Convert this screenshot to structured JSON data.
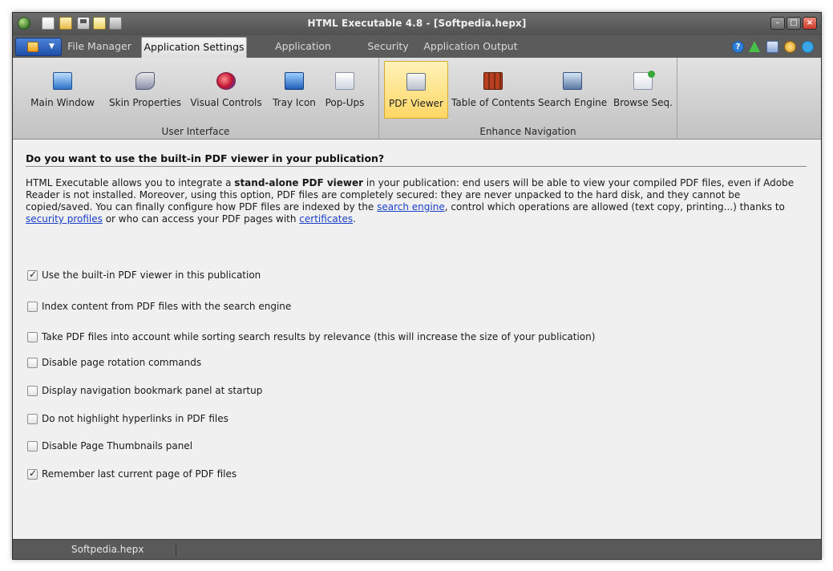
{
  "window": {
    "title": "HTML Executable 4.8 - [Softpedia.hepx]"
  },
  "quick_access": [
    "app-icon",
    "new-file-icon",
    "open-file-icon",
    "save-icon",
    "edit-icon",
    "build-icon"
  ],
  "tabs": [
    {
      "label": "File Manager",
      "active": false
    },
    {
      "label": "Application Settings",
      "active": true
    },
    {
      "label": "Application Behavior",
      "active": false
    },
    {
      "label": "Security",
      "active": false
    },
    {
      "label": "Application Output",
      "active": false
    }
  ],
  "top_right_icons": [
    "help-icon",
    "update-icon",
    "network-icon",
    "star-icon",
    "twitter-icon"
  ],
  "ribbon": {
    "groups": [
      {
        "label": "User Interface",
        "buttons": [
          {
            "label": "Main Window",
            "icon": "monitor-icon"
          },
          {
            "label": "Skin Properties",
            "icon": "brush-icon"
          },
          {
            "label": "Visual Controls",
            "icon": "controls-icon"
          },
          {
            "label": "Tray Icon",
            "icon": "tray-icon"
          },
          {
            "label": "Pop-Ups",
            "icon": "popups-icon"
          }
        ]
      },
      {
        "label": "Enhance Navigation",
        "buttons": [
          {
            "label": "PDF Viewer",
            "icon": "pdf-viewer-icon",
            "selected": true
          },
          {
            "label": "Table of Contents",
            "icon": "books-icon"
          },
          {
            "label": "Search Engine",
            "icon": "search-engine-icon"
          },
          {
            "label": "Browse Seq.",
            "icon": "browse-sequence-icon"
          }
        ]
      }
    ]
  },
  "content": {
    "heading": "Do you want to use the built-in PDF viewer in your publication?",
    "desc": {
      "p1": "HTML Executable allows you to integrate a ",
      "b1": "stand-alone PDF viewer",
      "p2": " in your publication: end users will be able to view your compiled PDF files, even if Adobe Reader is not installed. Moreover, using this option, PDF files are completely secured: they are never unpacked to the hard disk, and they cannot be copied/saved. You can finally configure how PDF files are indexed by the ",
      "link1": "search engine",
      "p3": ", control which operations are allowed (text copy, printing...) thanks to ",
      "link2": "security profiles",
      "p4": " or who can access your PDF pages with ",
      "link3": "certificates",
      "p5": "."
    },
    "options": [
      {
        "label": "Use the built-in PDF viewer in this publication",
        "checked": true
      },
      {
        "label": "Index content from PDF files with the search engine",
        "checked": false
      },
      {
        "label": "Take PDF files into account while sorting search results by relevance (this will increase the size of your publication)",
        "checked": false
      },
      {
        "label": "Disable page rotation commands",
        "checked": false
      },
      {
        "label": "Display navigation bookmark panel at startup",
        "checked": false
      },
      {
        "label": "Do not highlight hyperlinks in PDF files",
        "checked": false
      },
      {
        "label": "Disable Page Thumbnails panel",
        "checked": false
      },
      {
        "label": "Remember last current page of PDF files",
        "checked": true
      }
    ]
  },
  "status": {
    "file": "Softpedia.hepx"
  },
  "colors": {
    "accent_selected": "#ffd766",
    "link": "#1a3fc8",
    "chrome": "#5a5a5a",
    "menu_button": "#1f4fa8"
  }
}
